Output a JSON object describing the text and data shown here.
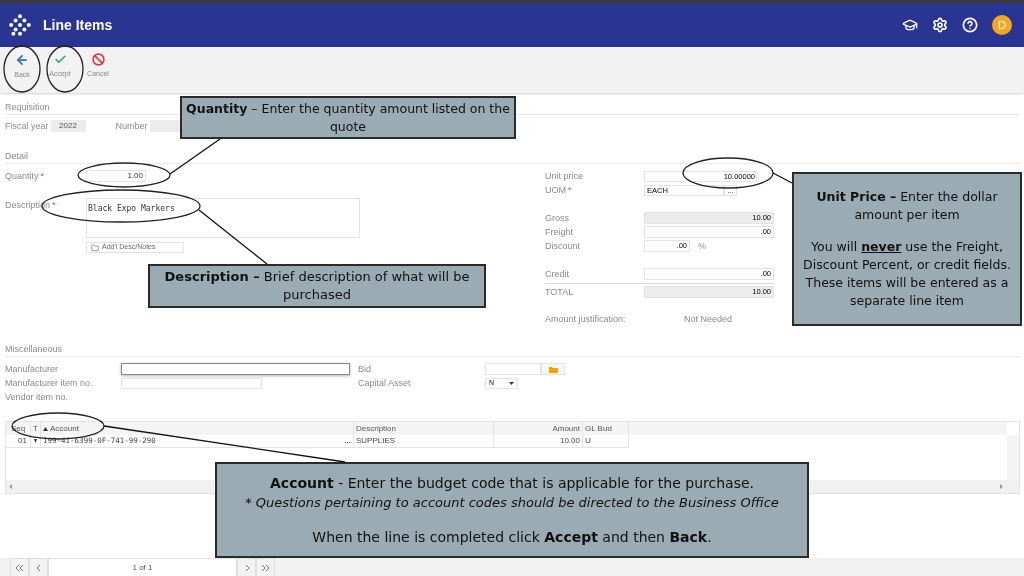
{
  "header": {
    "title": "Line Items",
    "avatar": "D"
  },
  "toolbar": [
    {
      "kind": "back",
      "label": "Back"
    },
    {
      "kind": "accept",
      "label": "Accept"
    },
    {
      "kind": "cancel",
      "label": "Cancel"
    }
  ],
  "requisition": {
    "heading": "Requisition",
    "fiscal_year": {
      "label": "Fiscal year",
      "value": "2022"
    },
    "number": {
      "label": "Number"
    }
  },
  "detail": {
    "heading": "Detail",
    "quantity": {
      "label": "Quantity",
      "required_mark": "*",
      "value": "1.00"
    },
    "description": {
      "label": "Description",
      "required_mark": "*",
      "value": "Black Expo Markers"
    },
    "notes_button": "Add'l Desc/Notes",
    "unit_price": {
      "label": "Unit price",
      "value": "10.00000"
    },
    "uom": {
      "label": "UOM",
      "required_mark": "*",
      "value": "EACH",
      "button": "..."
    },
    "amounts": [
      {
        "label": "Gross",
        "value": "10.00",
        "readonly": true
      },
      {
        "label": "Freight",
        "value": ".00",
        "readonly": false
      },
      {
        "label": "Discount",
        "value": ".00",
        "readonly": false,
        "suffix": "%"
      },
      {
        "label": "Credit",
        "value": ".00",
        "readonly": false
      },
      {
        "label": "TOTAL",
        "value": "10.00",
        "readonly": true
      }
    ],
    "amount_justification": {
      "label": "Amount justification:",
      "value": "Not Needed"
    }
  },
  "miscellaneous": {
    "heading": "Miscellaneous",
    "manufacturer": {
      "label": "Manufacturer",
      "focused": true
    },
    "manufacturer_item_no": {
      "label": "Manufacturer item no."
    },
    "vendor_item_no": {
      "label": "Vendor item no."
    },
    "bid": {
      "label": "Bid"
    },
    "capital_asset": {
      "label": "Capital Asset",
      "value": "N"
    }
  },
  "table": {
    "columns": [
      {
        "label": "Seq",
        "sorted": false
      },
      {
        "label": "T",
        "sorted": false
      },
      {
        "label": "Account",
        "sorted": true
      },
      {
        "label": "Description",
        "sorted": false
      },
      {
        "label": "Amount",
        "sorted": false
      },
      {
        "label": "GL Bud",
        "sorted": false
      }
    ],
    "rows": [
      {
        "seq": "01",
        "account": "199-41-6399-0F-741-99-290",
        "lookup": "...",
        "description": "SUPPLIES",
        "amount": "10.00",
        "gl_bud": "U"
      }
    ]
  },
  "pager": {
    "page": "1 of 1"
  },
  "callouts": [
    {
      "kind": "quantity",
      "paragraphs": [
        {
          "kind": "plain",
          "text": "**Quantity** – Enter the quantity amount listed on the quote"
        }
      ]
    },
    {
      "kind": "description",
      "paragraphs": [
        {
          "kind": "plain",
          "text": "**Description –** Brief description of what will be purchased"
        }
      ]
    },
    {
      "kind": "unit_price",
      "paragraphs": [
        {
          "kind": "plain",
          "text": "**Unit Price –** Enter the dollar amount per item"
        },
        {
          "kind": "emphasis",
          "before": "You will ",
          "emphasis": "never",
          "after": " use the Freight, Discount Percent, or credit fields. These items will be entered as a separate line item"
        }
      ]
    },
    {
      "kind": "account",
      "paragraphs": [
        {
          "kind": "plain",
          "text": "**Account** - Enter the budget code that is applicable for the purchase."
        },
        {
          "kind": "note",
          "text": "* Questions pertaining to account codes should be directed to the Business Office"
        },
        {
          "kind": "plain",
          "text": "When the line is completed click **Accept** and then **Back**."
        }
      ]
    }
  ]
}
